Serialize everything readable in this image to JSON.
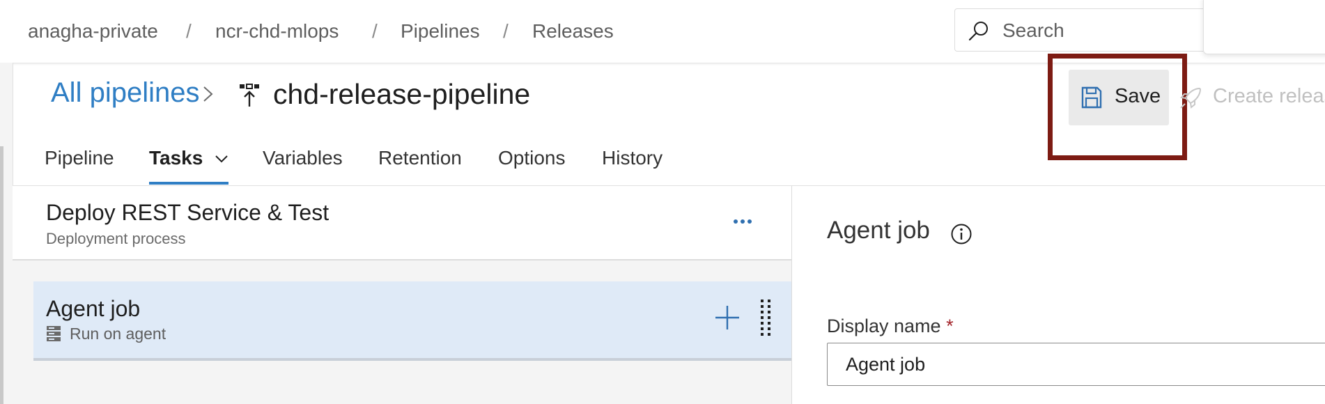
{
  "breadcrumb": [
    "anagha-private",
    "ncr-chd-mlops",
    "Pipelines",
    "Releases"
  ],
  "breadcrumb_separator": "/",
  "search": {
    "placeholder": "Search"
  },
  "page": {
    "all_pipelines_link": "All pipelines",
    "pipeline_name": "chd-release-pipeline"
  },
  "toolbar": {
    "save_label": "Save",
    "create_release_label": "Create releas"
  },
  "tabs": [
    {
      "label": "Pipeline"
    },
    {
      "label": "Tasks"
    },
    {
      "label": "Variables"
    },
    {
      "label": "Retention"
    },
    {
      "label": "Options"
    },
    {
      "label": "History"
    }
  ],
  "active_tab": "Tasks",
  "process": {
    "title": "Deploy REST Service & Test",
    "subtitle": "Deployment process"
  },
  "agent_job_row": {
    "title": "Agent job",
    "subtitle": "Run on agent"
  },
  "details": {
    "title": "Agent job",
    "display_name_label": "Display name",
    "required_marker": "*",
    "display_name_value": "Agent job"
  },
  "colors": {
    "accent": "#2f7ec4",
    "highlight_box": "#7d1b13",
    "selected_row": "#dfeaf7",
    "required": "#a4262c"
  },
  "icons": [
    "search-icon",
    "chevron-right-icon",
    "release-pipeline-icon",
    "save-icon",
    "rocket-icon",
    "chevron-down-icon",
    "more-icon",
    "server-icon",
    "plus-icon",
    "drag-handle-icon",
    "info-icon"
  ]
}
